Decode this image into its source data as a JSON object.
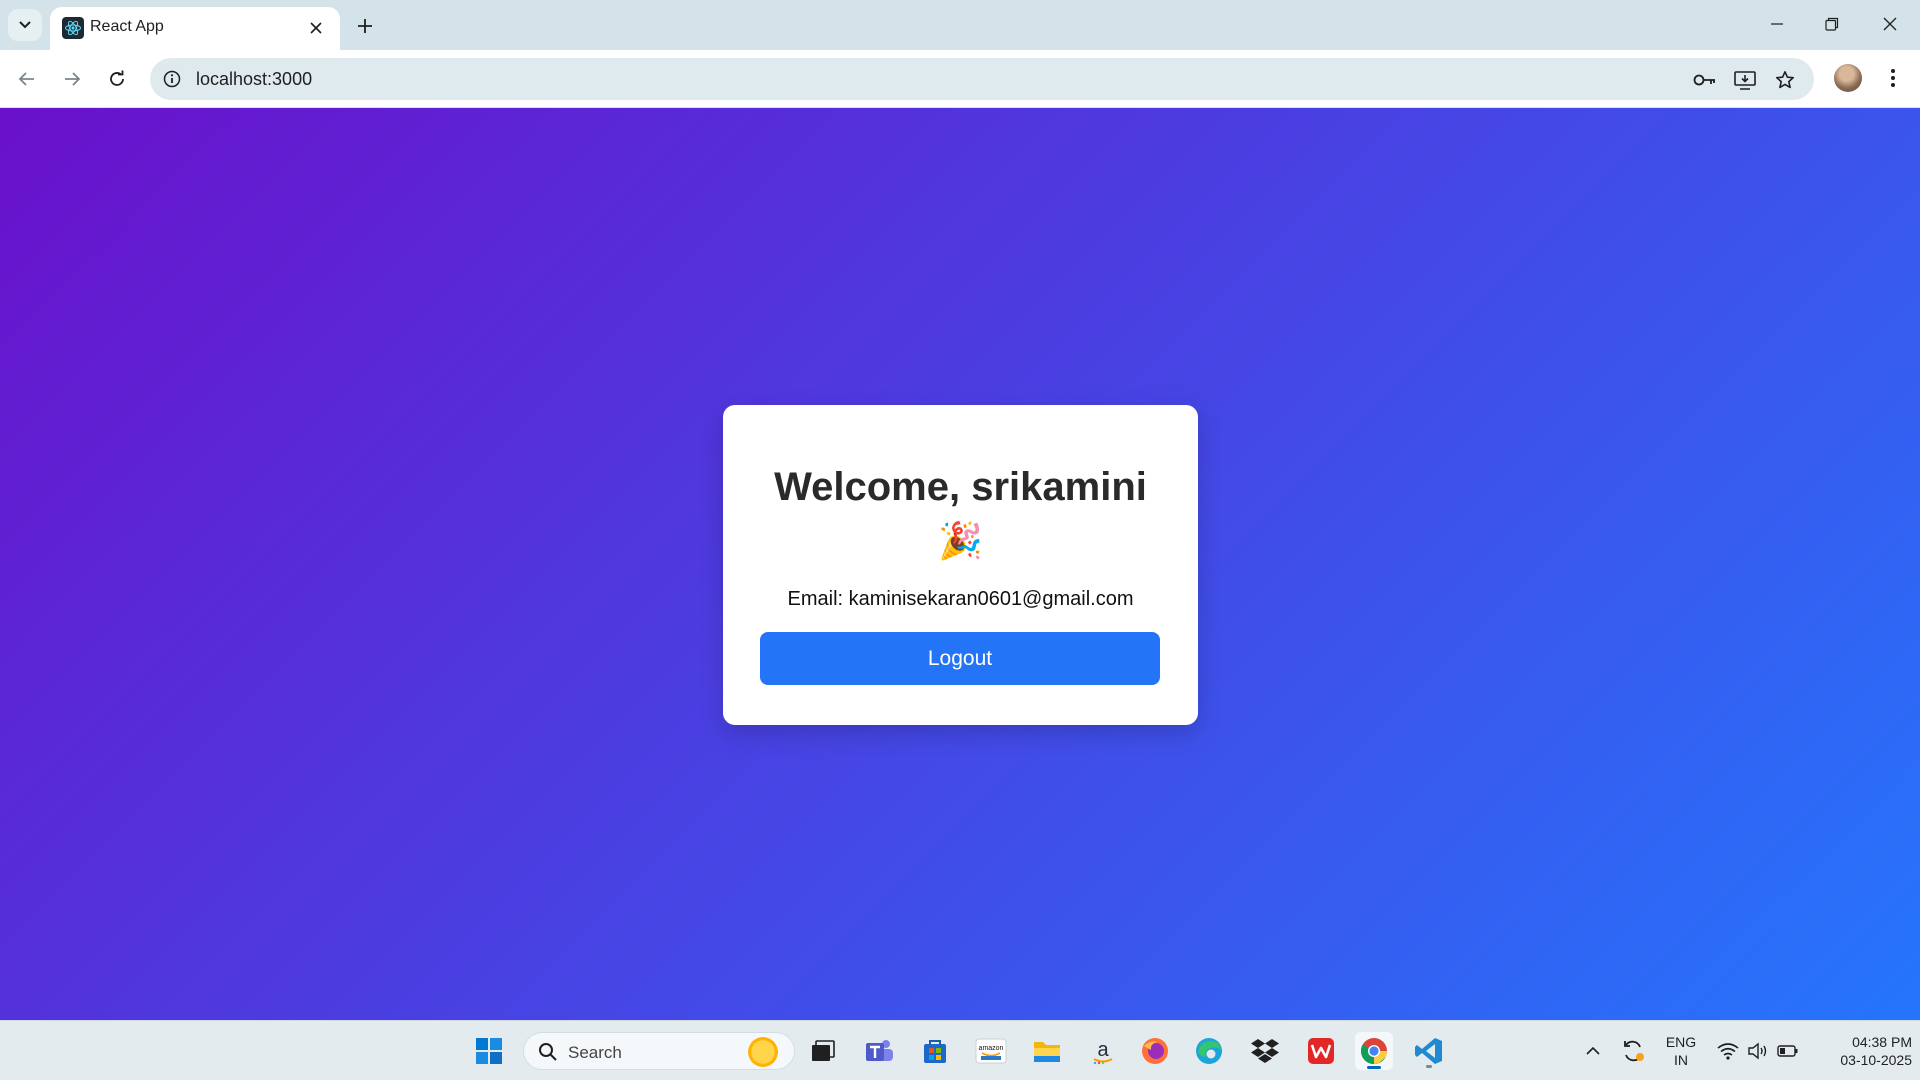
{
  "browser": {
    "tab_title": "React App",
    "url": "localhost:3000"
  },
  "page": {
    "welcome_text": "Welcome, srikamini",
    "celebration_emoji": "🎉",
    "email_line": "Email: kaminisekaran0601@gmail.com",
    "logout_label": "Logout",
    "background_gradient": [
      "#6a11cb",
      "#2575fc"
    ],
    "button_color": "#2474f7"
  },
  "taskbar": {
    "search_placeholder": "Search",
    "apps": [
      "start-icon",
      "search-icon",
      "weather-sun-icon",
      "task-view-icon",
      "teams-icon",
      "microsoft-store-icon",
      "amazon-icon",
      "file-explorer-icon",
      "amazon-appstore-icon",
      "firefox-icon",
      "edge-icon",
      "dropbox-icon",
      "wps-office-icon",
      "chrome-icon",
      "vscode-icon"
    ],
    "language_top": "ENG",
    "language_bottom": "IN",
    "time": "04:38 PM",
    "date": "03-10-2025"
  }
}
